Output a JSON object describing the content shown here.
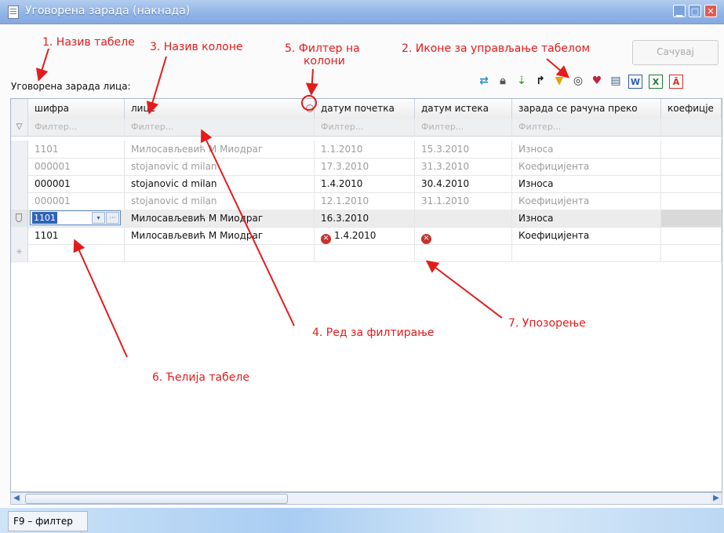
{
  "window": {
    "title": "Уговорена зарада (накнада)"
  },
  "save_label": "Сачувај",
  "table_title": "Уговорена зарада лица:",
  "toolbar_icons": [
    "refresh-icon",
    "lock-icon",
    "expand-icon",
    "redirect-icon",
    "filter-icon",
    "view-icon",
    "favorite-icon",
    "print-icon",
    "word-export-icon",
    "excel-export-icon",
    "pdf-export-icon"
  ],
  "columns": [
    "шифра",
    "лице",
    "датум почетка",
    "датум истека",
    "зарада се рачуна преко",
    "коефицје"
  ],
  "filter_placeholder": "Филтер...",
  "rows": [
    {
      "sifra": "1101",
      "lice": "Милосављевић М  Миодраг",
      "pocetak": "1.1.2010",
      "istek": "15.3.2010",
      "preko": "Износа"
    },
    {
      "sifra": "000001",
      "lice": "stojanovic d milan",
      "pocetak": "17.3.2010",
      "istek": "31.3.2010",
      "preko": "Коефицијента"
    },
    {
      "sifra": "000001",
      "lice": "stojanovic d milan",
      "pocetak": "1.4.2010",
      "istek": "30.4.2010",
      "preko": "Износа"
    },
    {
      "sifra": "000001",
      "lice": "stojanovic d milan",
      "pocetak": "12.1.2010",
      "istek": "31.1.2010",
      "preko": "Коефицијента"
    },
    {
      "sifra": "1101",
      "lice": "Милосављевић М  Миодраг",
      "pocetak": "16.3.2010",
      "istek": "",
      "preko": "Износа"
    },
    {
      "sifra": "1101",
      "lice": "Милосављевић М  Миодраг",
      "pocetak": "1.4.2010",
      "istek": "",
      "preko": "Коефицијента"
    }
  ],
  "status_tab": "F9 – филтер",
  "annotations": {
    "a1": "1. Назив табеле",
    "a2": "2. Иконе за управљање табелом",
    "a3": "3. Назив колоне",
    "a4": "4. Ред за филтирање",
    "a5a": "5. Филтер на",
    "a5b": "колони",
    "a6": "6. Ћелија табеле",
    "a7": "7. Упозорење"
  },
  "colors": {
    "annotation": "#e41b1b",
    "title_bar": "#8fb3e6",
    "error": "#c8322c"
  }
}
